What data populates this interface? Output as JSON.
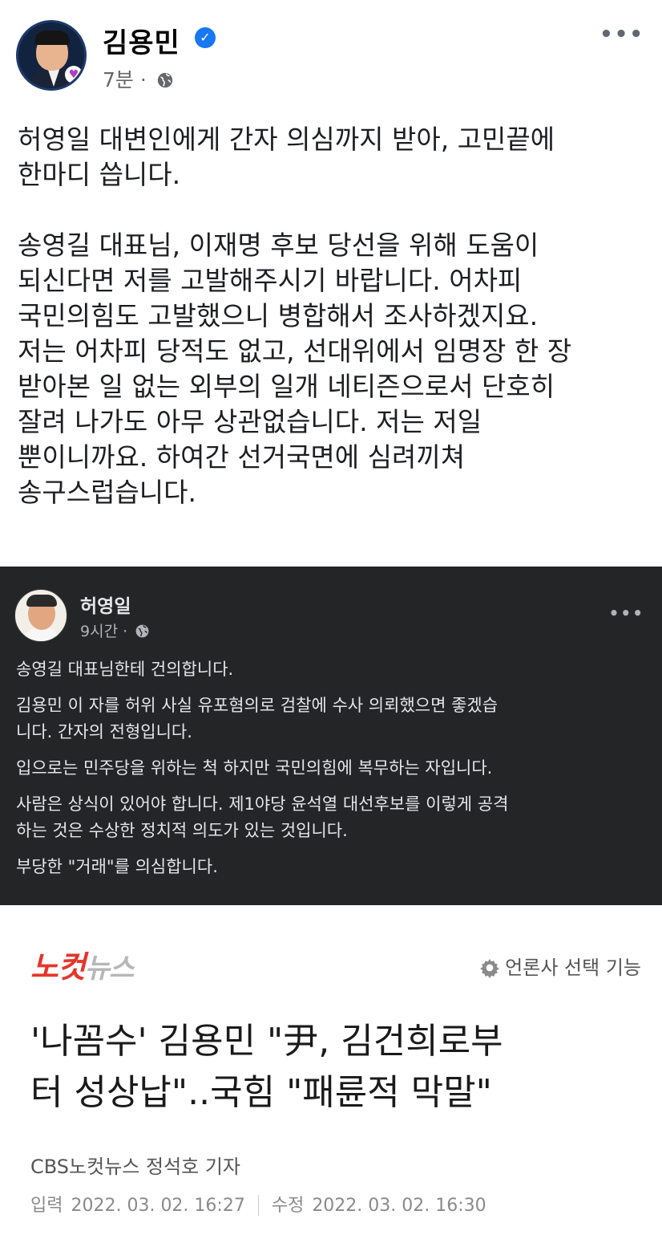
{
  "post": {
    "author": "김용민",
    "time": "7분",
    "separator": "·",
    "paragraphs": [
      "허영일 대변인에게 간자 의심까지 받아, 고민끝에\n한마디 씁니다.",
      "송영길 대표님, 이재명 후보 당선을 위해 도움이\n되신다면 저를 고발해주시기 바랍니다. 어차피\n국민의힘도 고발했으니 병합해서 조사하겠지요.\n저는 어차피 당적도 없고, 선대위에서 임명장 한 장\n받아본 일 없는 외부의 일개 네티즌으로서 단호히\n잘려 나가도 아무 상관없습니다. 저는 저일\n뿐이니까요. 하여간 선거국면에 심려끼쳐\n송구스럽습니다."
    ]
  },
  "embedded": {
    "author": "허영일",
    "time": "9시간",
    "separator": "·",
    "paragraphs": [
      "송영길 대표님한테 건의합니다.",
      "김용민 이 자를 허위 사실 유포혐의로 검찰에 수사 의뢰했으면 좋겠습\n니다. 간자의 전형입니다.",
      "입으로는 민주당을 위하는 척 하지만 국민의힘에 복무하는 자입니다.",
      "사람은 상식이 있어야 합니다. 제1야당 윤석열 대선후보를 이렇게 공격\n하는 것은 수상한 정치적 의도가 있는 것입니다.",
      "부당한 \"거래\"를 의심합니다."
    ]
  },
  "news": {
    "logo_main": "노컷",
    "logo_sub": "뉴스",
    "press_select": "언론사 선택 기능",
    "headline": "'나꼼수' 김용민 \"尹, 김건희로부\n터 성상납\"..국힘 \"패륜적 막말\"",
    "reporter": "CBS노컷뉴스 정석호 기자",
    "input_label": "입력",
    "input_date": "2022. 03. 02. 16:27",
    "edit_label": "수정",
    "edit_date": "2022. 03. 02. 16:30"
  },
  "icons": {
    "verified": "verified-badge-icon",
    "globe": "globe-icon",
    "more": "more-options-icon",
    "gear": "gear-icon"
  },
  "colors": {
    "verified_blue": "#1877f2",
    "dark_bg": "#242526",
    "logo_red": "#e5352b"
  }
}
